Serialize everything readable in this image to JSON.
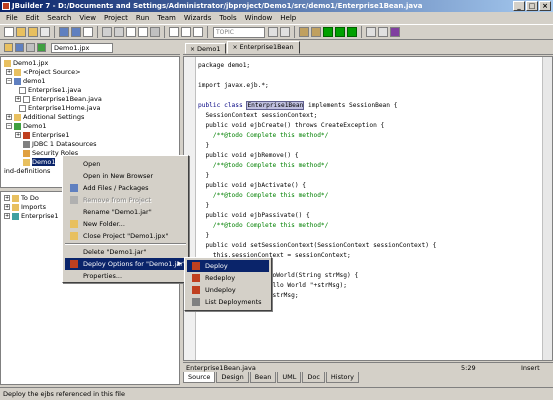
{
  "window": {
    "title": "JBuilder 7 - D:/Documents and Settings/Administrator/jbproject/Demo1/src/demo1/Enterprise1Bean.java"
  },
  "menubar": [
    "File",
    "Edit",
    "Search",
    "View",
    "Project",
    "Run",
    "Team",
    "Wizards",
    "Tools",
    "Window",
    "Help"
  ],
  "toolbar": {
    "combo_value": "TOPIC"
  },
  "left_pane": {
    "project_combo": "Demo1.jpx",
    "tree": [
      "Demo1.jpx",
      "<Project Source>",
      "demo1",
      "Enterprise1.java",
      "Enterprise1Bean.java",
      "Enterprise1Home.java",
      "Additional Settings",
      "Demo1",
      "Enterprise1",
      "JDBC 1 Datasources",
      "Security Roles",
      "Demo1",
      "ind-definitions"
    ],
    "structure_tree": [
      "To Do",
      "Imports",
      "Enterprise1"
    ]
  },
  "context_menu": {
    "items": [
      "Open",
      "Open in New Browser",
      "Add Files / Packages",
      "Remove from Project",
      "Rename \"Demo1.jar\"",
      "New Folder...",
      "Close Project \"Demo1.jpx\"",
      "Delete \"Demo1.jar\"",
      "Deploy Options for \"Demo1.jar\"",
      "Properties..."
    ]
  },
  "submenu": {
    "items": [
      "Deploy",
      "Redeploy",
      "Undeploy",
      "List Deployments"
    ]
  },
  "editor": {
    "tabs": [
      "Demo1",
      "Enterprise1Bean"
    ],
    "code_lines": [
      {
        "text": "package demo1;",
        "type": "plain"
      },
      {
        "text": "",
        "type": "plain"
      },
      {
        "text": "import javax.ejb.*;",
        "type": "plain"
      },
      {
        "text": "",
        "type": "plain"
      },
      {
        "pre": "public class ",
        "hl": "Enterprise1Bean",
        "post": " implements SessionBean {",
        "type": "hl"
      },
      {
        "text": "  SessionContext sessionContext;",
        "type": "plain"
      },
      {
        "text": "  public void ejbCreate() throws CreateException {",
        "type": "plain"
      },
      {
        "text": "    /**@todo Complete this method*/",
        "type": "comment"
      },
      {
        "text": "  }",
        "type": "plain"
      },
      {
        "text": "  public void ejbRemove() {",
        "type": "plain"
      },
      {
        "text": "    /**@todo Complete this method*/",
        "type": "comment"
      },
      {
        "text": "  }",
        "type": "plain"
      },
      {
        "text": "  public void ejbActivate() {",
        "type": "plain"
      },
      {
        "text": "    /**@todo Complete this method*/",
        "type": "comment"
      },
      {
        "text": "  }",
        "type": "plain"
      },
      {
        "text": "  public void ejbPassivate() {",
        "type": "plain"
      },
      {
        "text": "    /**@todo Complete this method*/",
        "type": "comment"
      },
      {
        "text": "  }",
        "type": "plain"
      },
      {
        "text": "  public void setSessionContext(SessionContext sessionContext) {",
        "type": "plain"
      },
      {
        "text": "    this.sessionContext = sessionContext;",
        "type": "plain"
      },
      {
        "text": "  }",
        "type": "plain"
      },
      {
        "text": "  public String helloWorld(String strMsg) {",
        "type": "plain"
      },
      {
        "text": "         println(\"Hello World \"+strMsg);",
        "type": "plain"
      },
      {
        "text": "         lo World \"+strMsg;",
        "type": "plain"
      }
    ],
    "file_name": "Enterprise1Bean.java",
    "cursor_pos": "5:29",
    "mode": "Insert",
    "bottom_tabs": [
      "Source",
      "Design",
      "Bean",
      "UML",
      "Doc",
      "History"
    ]
  },
  "statusbar": {
    "text": "Deploy the ejbs referenced in this file"
  },
  "colors": {
    "selection": "#0a246a",
    "title_start": "#0a246a",
    "title_end": "#a6caf0",
    "face": "#d4d0c8",
    "comment": "#008000",
    "keyword": "#000080"
  }
}
